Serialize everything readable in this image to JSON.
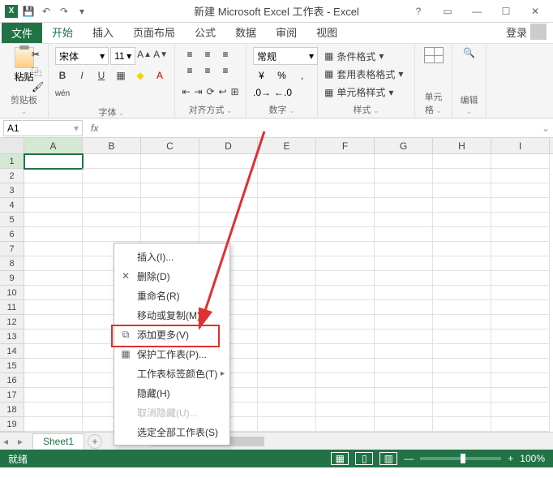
{
  "title": "新建 Microsoft Excel 工作表 - Excel",
  "app_icon_text": "X",
  "tabs": {
    "file": "文件",
    "home": "开始",
    "insert": "插入",
    "layout": "页面布局",
    "formulas": "公式",
    "data": "数据",
    "review": "审阅",
    "view": "视图",
    "login": "登录"
  },
  "ribbon": {
    "clipboard": {
      "paste": "粘贴",
      "label": "剪贴板"
    },
    "font": {
      "name": "宋体",
      "size": "11",
      "label": "字体"
    },
    "align": {
      "label": "对齐方式"
    },
    "number": {
      "format": "常规",
      "label": "数字"
    },
    "styles": {
      "cond": "条件格式",
      "table": "套用表格格式",
      "cell": "单元格样式",
      "label": "样式"
    },
    "cells": {
      "label": "单元格"
    },
    "edit": {
      "label": "编辑"
    }
  },
  "name_box": "A1",
  "fx": "fx",
  "columns": [
    "A",
    "B",
    "C",
    "D",
    "E",
    "F",
    "G",
    "H",
    "I"
  ],
  "row_count": 19,
  "sheet": "Sheet1",
  "add_sheet": "+",
  "status": "就绪",
  "zoom": "100%",
  "context": {
    "insert": "插入(I)...",
    "delete": "删除(D)",
    "rename": "重命名(R)",
    "move": "移动或复制(M)...",
    "add_more": "添加更多(V)",
    "protect": "保护工作表(P)...",
    "tab_color": "工作表标签颜色(T)",
    "hide": "隐藏(H)",
    "unhide": "取消隐藏(U)...",
    "select_all": "选定全部工作表(S)"
  }
}
